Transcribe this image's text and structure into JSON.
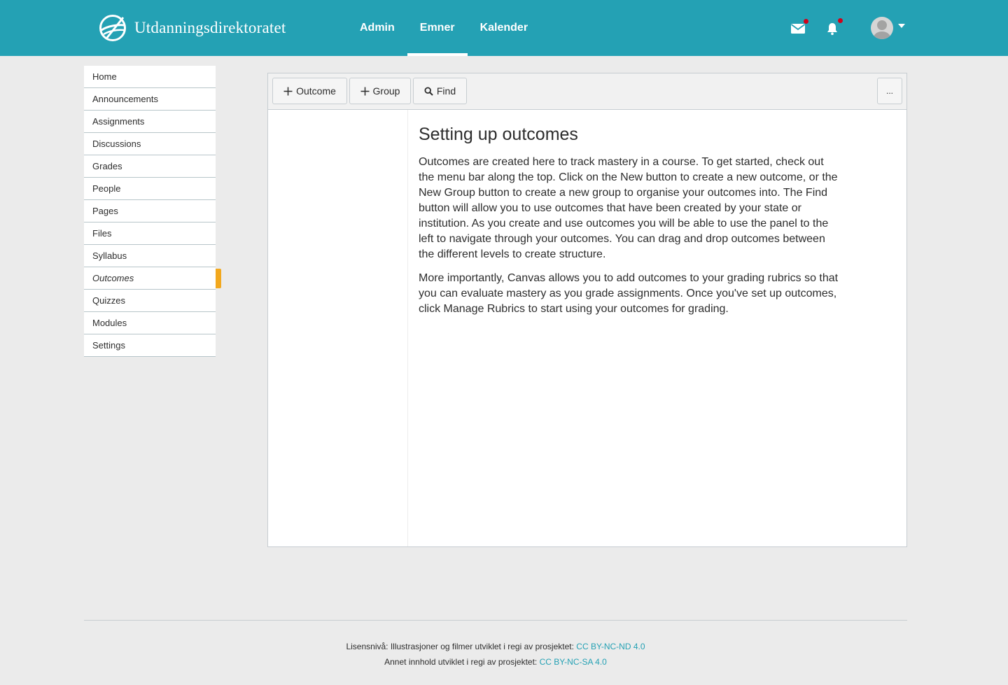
{
  "header": {
    "brand_name": "Utdanningsdirektoratet",
    "nav": [
      {
        "label": "Admin",
        "active": false
      },
      {
        "label": "Emner",
        "active": true
      },
      {
        "label": "Kalender",
        "active": false
      }
    ],
    "icons": [
      "mail-icon",
      "bell-icon",
      "user-avatar",
      "chevron-down-icon"
    ],
    "colors": {
      "bar": "#24a1b4",
      "notification_dot": "#d0021b"
    }
  },
  "sidebar": {
    "items": [
      {
        "label": "Home"
      },
      {
        "label": "Announcements"
      },
      {
        "label": "Assignments"
      },
      {
        "label": "Discussions"
      },
      {
        "label": "Grades"
      },
      {
        "label": "People"
      },
      {
        "label": "Pages"
      },
      {
        "label": "Files"
      },
      {
        "label": "Syllabus"
      },
      {
        "label": "Outcomes",
        "active": true
      },
      {
        "label": "Quizzes"
      },
      {
        "label": "Modules"
      },
      {
        "label": "Settings"
      }
    ],
    "active_color": "#f2a81e"
  },
  "toolbar": {
    "outcome_label": "Outcome",
    "group_label": "Group",
    "find_label": "Find",
    "more_label": "..."
  },
  "content": {
    "title": "Setting up outcomes",
    "paragraph_1": "Outcomes are created here to track mastery in a course. To get started, check out the menu bar along the top. Click on the New button to create a new outcome, or the New Group button to create a new group to organise your outcomes into. The Find button will allow you to use outcomes that have been created by your state or institution. As you create and use outcomes you will be able to use the panel to the left to navigate through your outcomes. You can drag and drop outcomes between the different levels to create structure.",
    "paragraph_2": "More importantly, Canvas allows you to add outcomes to your grading rubrics so that you can evaluate mastery as you grade assignments. Once you've set up outcomes, click Manage Rubrics to start using your outcomes for grading."
  },
  "footer": {
    "line1_text": "Lisensnivå: Illustrasjoner og filmer utviklet i regi av prosjektet: ",
    "line1_link": "CC BY-NC-ND 4.0",
    "line2_text": "Annet innhold utviklet i regi av prosjektet: ",
    "line2_link": "CC BY-NC-SA 4.0",
    "link_color": "#24a1b4"
  }
}
